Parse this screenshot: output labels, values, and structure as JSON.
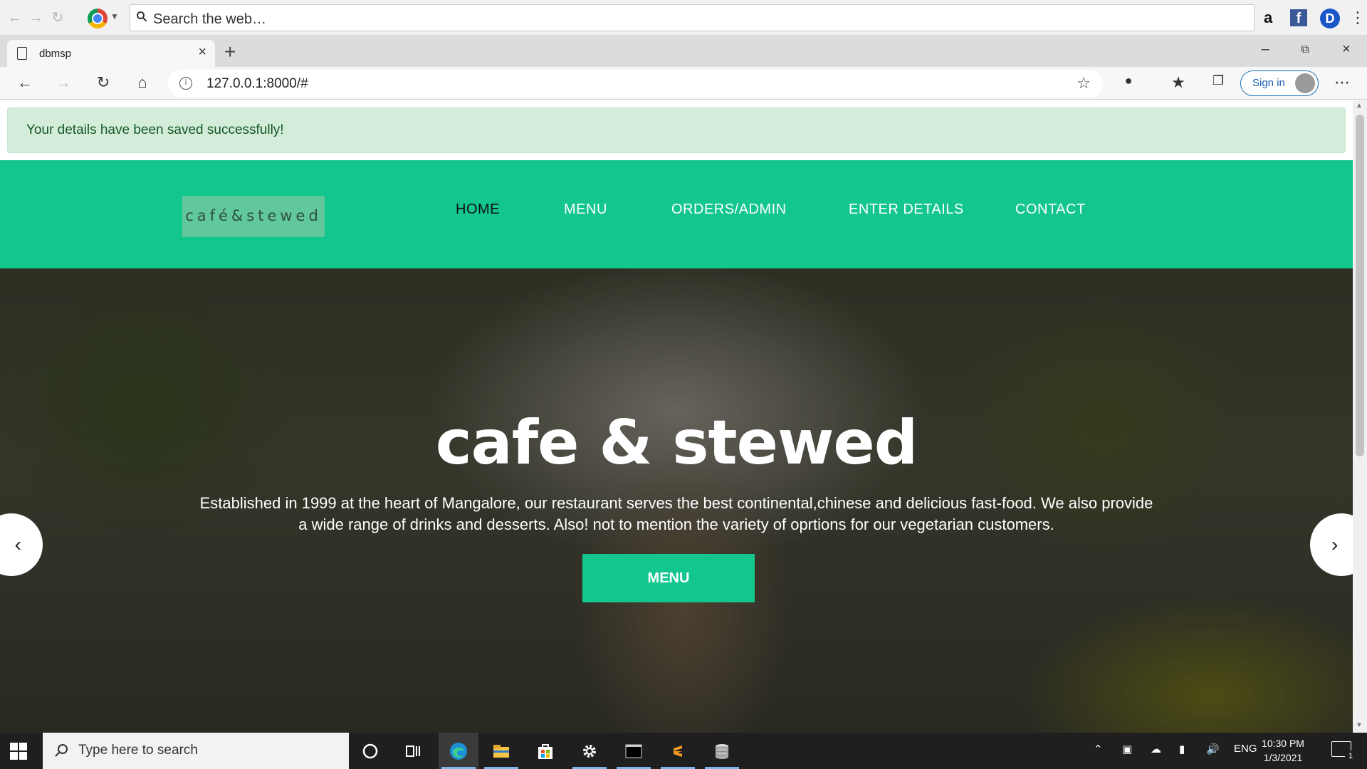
{
  "ext_toolbar": {
    "search_placeholder": "Search the web…",
    "amazon_glyph": "a",
    "facebook_glyph": "f",
    "profile_glyph": "D"
  },
  "tab": {
    "title": "dbmsp"
  },
  "address": {
    "url": "127.0.0.1:8000/#",
    "signin_label": "Sign in"
  },
  "alert": {
    "message": "Your details have been saved successfully!"
  },
  "site": {
    "logo_text": "café&stewed",
    "nav": [
      {
        "label": "HOME",
        "active": true
      },
      {
        "label": "MENU",
        "active": false
      },
      {
        "label": "ORDERS/ADMIN",
        "active": false
      },
      {
        "label": "ENTER DETAILS",
        "active": false
      },
      {
        "label": "CONTACT",
        "active": false
      }
    ],
    "hero": {
      "title": "cafe & stewed",
      "text": "Established in 1999 at the heart of Mangalore, our restaurant serves the best continental,chinese and delicious fast-food. We also provide a wide range of drinks and desserts. Also! not to mention the variety of oprtions for our vegetarian customers.",
      "button_label": "MENU"
    },
    "accent_color": "#13c68e"
  },
  "taskbar": {
    "search_placeholder": "Type here to search",
    "language": "ENG",
    "time": "10:30 PM",
    "date": "1/3/2021",
    "notification_count": "1"
  }
}
